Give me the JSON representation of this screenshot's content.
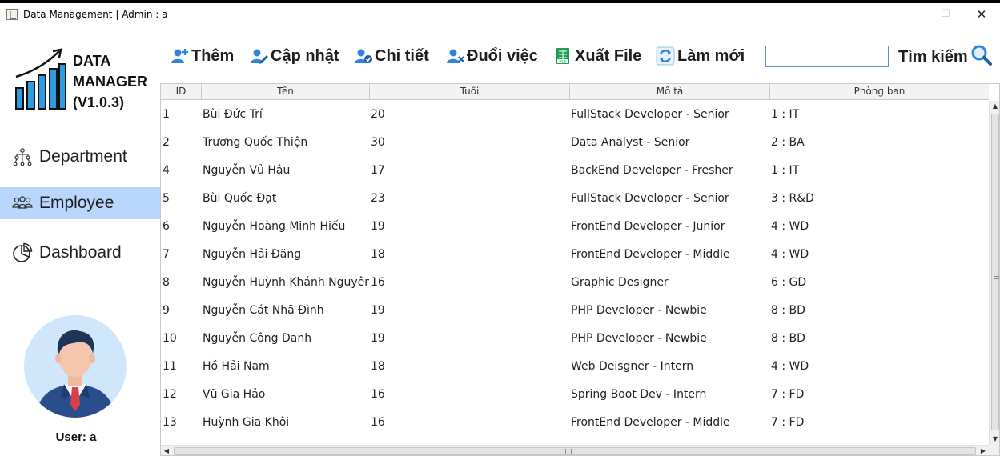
{
  "window": {
    "title": "Data Management | Admin : a",
    "min_glyph": "—",
    "max_glyph": "☐",
    "close_glyph": "✕"
  },
  "logo": {
    "line1": "DATA",
    "line2": "MANAGER",
    "line3": "(V1.0.3)",
    "icon": "bar-chart-growth-icon"
  },
  "sidebar": {
    "items": [
      {
        "label": "Department",
        "icon": "org-chart-icon",
        "active": false
      },
      {
        "label": "Employee",
        "icon": "people-group-icon",
        "active": true
      },
      {
        "label": "Dashboard",
        "icon": "pie-chart-icon",
        "active": false
      }
    ],
    "user_label": "User: a"
  },
  "toolbar": {
    "add_label": "Thêm",
    "update_label": "Cập nhật",
    "detail_label": "Chi tiết",
    "fire_label": "Đuổi việc",
    "export_label": "Xuất File",
    "refresh_label": "Làm mới",
    "search_value": "",
    "search_label": "Tìm kiếm"
  },
  "table": {
    "columns": [
      "ID",
      "Tên",
      "Tuổi",
      "Mô tả",
      "Phòng ban"
    ],
    "rows": [
      [
        "1",
        "Bùi Đức Trí",
        "20",
        "FullStack Developer - Senior",
        "1 : IT"
      ],
      [
        "2",
        "Trương Quốc Thiện",
        "30",
        "Data Analyst - Senior",
        "2 : BA"
      ],
      [
        "4",
        "Nguyễn Vủ Hậu",
        "17",
        "BackEnd Developer - Fresher",
        "1 : IT"
      ],
      [
        "5",
        "Bùi Quốc Đạt",
        "23",
        "FullStack Developer - Senior",
        "3 : R&D"
      ],
      [
        "6",
        "Nguyễn Hoàng Minh Hiếu",
        "19",
        "FrontEnd Developer - Junior",
        "4 : WD"
      ],
      [
        "7",
        "Nguyễn Hải Đăng",
        "18",
        "FrontEnd Developer - Middle",
        "4 : WD"
      ],
      [
        "8",
        "Nguyễn Huỳnh Khánh Nguyên",
        "16",
        "Graphic Designer",
        "6 : GD"
      ],
      [
        "9",
        "Nguyễn Cát Nhã Đình",
        "19",
        "PHP Developer - Newbie",
        "8 : BD"
      ],
      [
        "10",
        "Nguyễn Công Danh",
        "19",
        "PHP Developer - Newbie",
        "8 : BD"
      ],
      [
        "11",
        "Hồ Hải Nam",
        "18",
        "Web Deisgner - Intern",
        "4 : WD"
      ],
      [
        "12",
        "Vũ Gia Hảo",
        "16",
        "Spring Boot Dev - Intern",
        "7 : FD"
      ],
      [
        "13",
        "Huỳnh Gia Khôi",
        "16",
        "FrontEnd Developer - Middle",
        "7 : FD"
      ]
    ]
  },
  "colors": {
    "active_nav": "#b9d6ff",
    "icon_blue": "#2f86d6",
    "search_border": "#5a8ed0"
  }
}
